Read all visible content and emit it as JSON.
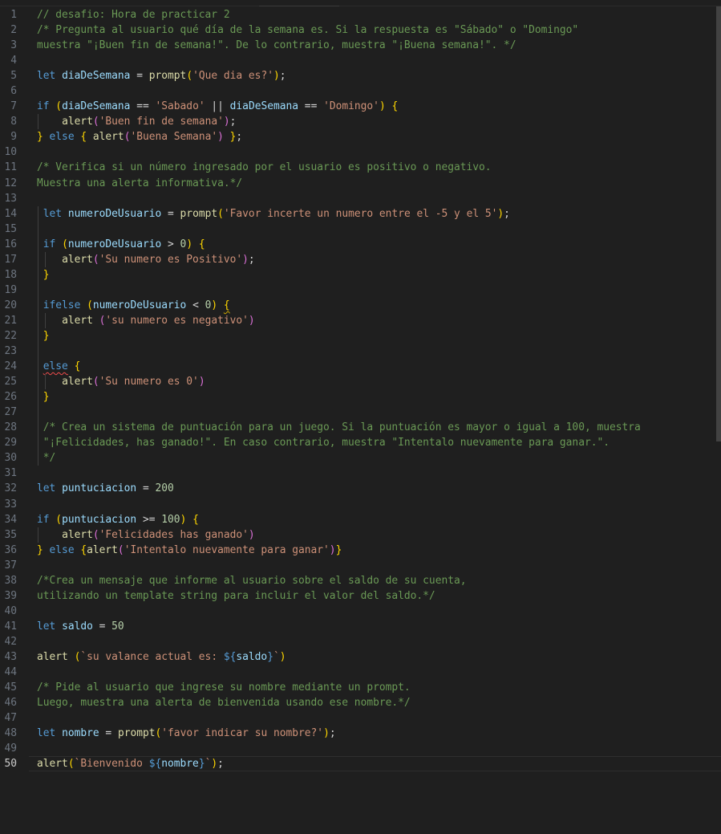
{
  "editor": {
    "language": "javascript",
    "active_line": 50,
    "total_lines": 50
  },
  "code_lines": [
    "// desafio: Hora de practicar 2",
    "/* Pregunta al usuario qué día de la semana es. Si la respuesta es \"Sábado\" o \"Domingo\"",
    "muestra \"¡Buen fin de semana!\". De lo contrario, muestra \"¡Buena semana!\". */",
    "",
    "let diaDeSemana = prompt('Que dia es?');",
    "",
    "if (diaDeSemana == 'Sabado' || diaDeSemana == 'Domingo') {",
    "    alert('Buen fin de semana');",
    "} else { alert('Buena Semana') };",
    "",
    "/* Verifica si un número ingresado por el usuario es positivo o negativo.",
    "Muestra una alerta informativa.*/",
    "",
    " let numeroDeUsuario = prompt('Favor incerte un numero entre el -5 y el 5');",
    "",
    " if (numeroDeUsuario > 0) {",
    "    alert('Su numero es Positivo');",
    " }",
    "",
    " ifelse (numeroDeUsuario < 0) {",
    "    alert ('su numero es negativo')",
    " }",
    "",
    " else {",
    "    alert('Su numero es 0')",
    " }",
    "",
    " /* Crea un sistema de puntuación para un juego. Si la puntuación es mayor o igual a 100, muestra",
    " \"¡Felicidades, has ganado!\". En caso contrario, muestra \"Intentalo nuevamente para ganar.\".",
    " */",
    "",
    "let puntuciacion = 200",
    "",
    "if (puntuciacion >= 100) {",
    "    alert('Felicidades has ganado')",
    "} else {alert('Intentalo nuevamente para ganar')}",
    "",
    "/*Crea un mensaje que informe al usuario sobre el saldo de su cuenta,",
    "utilizando un template string para incluir el valor del saldo.*/",
    "",
    "let saldo = 50",
    "",
    "alert (`su valance actual es: ${saldo}`)",
    "",
    "/* Pide al usuario que ingrese su nombre mediante un prompt.",
    "Luego, muestra una alerta de bienvenida usando ese nombre.*/",
    "",
    "let nombre = prompt('favor indicar su nombre?');",
    "",
    "alert(`Bienvenido ${nombre}`);"
  ]
}
